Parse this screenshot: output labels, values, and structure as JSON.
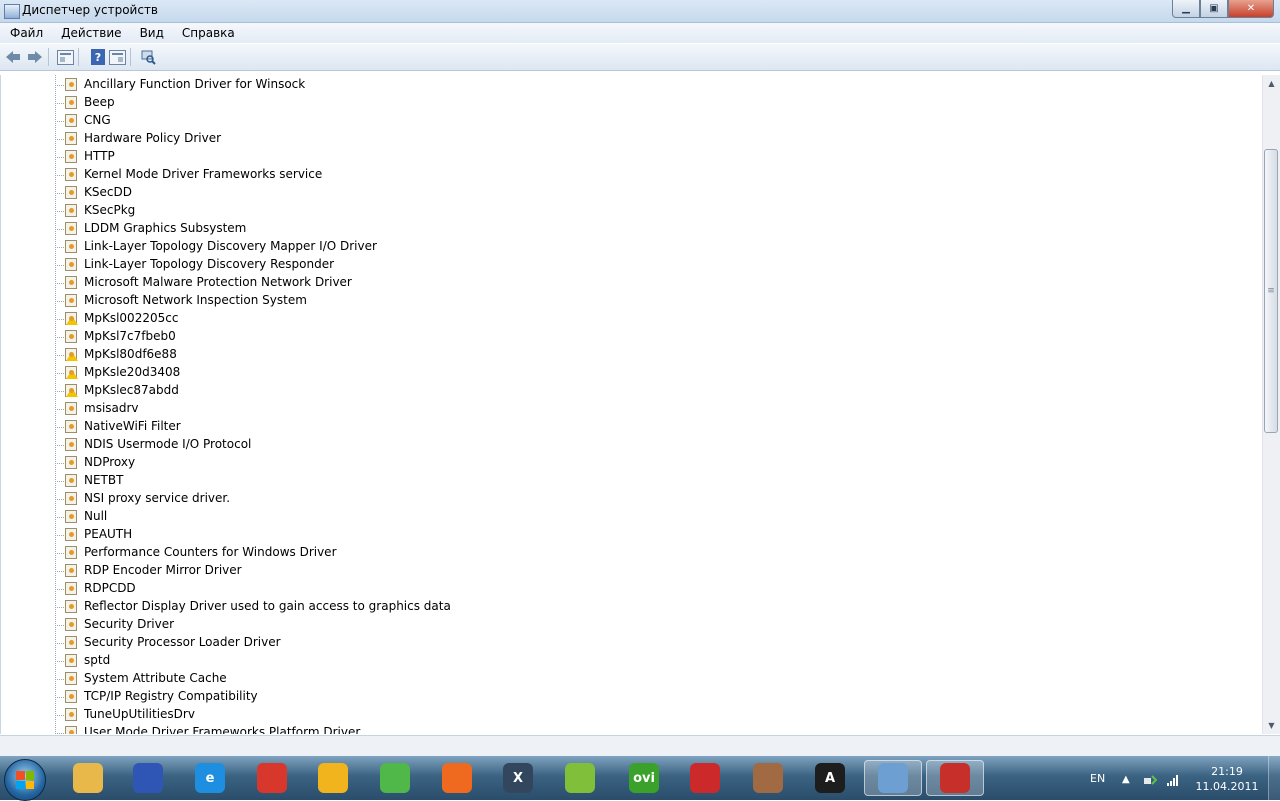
{
  "window": {
    "title": "Диспетчер устройств",
    "buttons": {
      "minimize": "▁",
      "maximize": "▣",
      "close": "✕"
    }
  },
  "menu": [
    "Файл",
    "Действие",
    "Вид",
    "Справка"
  ],
  "toolbar": {
    "back_icon": "back-arrow-icon",
    "forward_icon": "forward-arrow-icon",
    "properties_icon": "properties-icon",
    "help_icon": "help-icon",
    "help_label": "?",
    "view_icon": "view-icon",
    "scan_icon": "scan-hardware-icon"
  },
  "tree": {
    "items": [
      {
        "label": "Ancillary Function Driver for Winsock",
        "warn": false
      },
      {
        "label": "Beep",
        "warn": false
      },
      {
        "label": "CNG",
        "warn": false
      },
      {
        "label": "Hardware Policy Driver",
        "warn": false
      },
      {
        "label": "HTTP",
        "warn": false
      },
      {
        "label": "Kernel Mode Driver Frameworks service",
        "warn": false
      },
      {
        "label": "KSecDD",
        "warn": false
      },
      {
        "label": "KSecPkg",
        "warn": false
      },
      {
        "label": "LDDM Graphics Subsystem",
        "warn": false
      },
      {
        "label": "Link-Layer Topology Discovery Mapper I/O Driver",
        "warn": false
      },
      {
        "label": "Link-Layer Topology Discovery Responder",
        "warn": false
      },
      {
        "label": "Microsoft Malware Protection Network Driver",
        "warn": false
      },
      {
        "label": "Microsoft Network Inspection System",
        "warn": false
      },
      {
        "label": "MpKsl002205cc",
        "warn": true
      },
      {
        "label": "MpKsl7c7fbeb0",
        "warn": false
      },
      {
        "label": "MpKsl80df6e88",
        "warn": true
      },
      {
        "label": "MpKsle20d3408",
        "warn": true
      },
      {
        "label": "MpKslec87abdd",
        "warn": true
      },
      {
        "label": "msisadrv",
        "warn": false
      },
      {
        "label": "NativeWiFi Filter",
        "warn": false
      },
      {
        "label": "NDIS Usermode I/O Protocol",
        "warn": false
      },
      {
        "label": "NDProxy",
        "warn": false
      },
      {
        "label": "NETBT",
        "warn": false
      },
      {
        "label": "NSI proxy service driver.",
        "warn": false
      },
      {
        "label": "Null",
        "warn": false
      },
      {
        "label": "PEAUTH",
        "warn": false
      },
      {
        "label": "Performance Counters for Windows Driver",
        "warn": false
      },
      {
        "label": "RDP Encoder Mirror Driver",
        "warn": false
      },
      {
        "label": "RDPCDD",
        "warn": false
      },
      {
        "label": "Reflector Display Driver used to gain access to graphics data",
        "warn": false
      },
      {
        "label": "Security Driver",
        "warn": false
      },
      {
        "label": "Security Processor Loader Driver",
        "warn": false
      },
      {
        "label": "sptd",
        "warn": false
      },
      {
        "label": "System Attribute Cache",
        "warn": false
      },
      {
        "label": "TCP/IP Registry Compatibility",
        "warn": false
      },
      {
        "label": "TuneUpUtilitiesDrv",
        "warn": false
      },
      {
        "label": "User Mode Driver Frameworks Platform Driver",
        "warn": false
      }
    ]
  },
  "scrollbar": {
    "up": "▲",
    "down": "▼",
    "grip": "≡"
  },
  "taskbar": {
    "apps": [
      {
        "name": "explorer-icon",
        "glyph": "",
        "color": "#e8b84a",
        "active": false
      },
      {
        "name": "save-disk-icon",
        "glyph": "",
        "color": "#2f56b5",
        "active": false
      },
      {
        "name": "internet-explorer-icon",
        "glyph": "e",
        "color": "#1e8fe0",
        "active": false
      },
      {
        "name": "chrome-icon",
        "glyph": "",
        "color": "#d8372b",
        "active": false
      },
      {
        "name": "game-icon",
        "glyph": "",
        "color": "#f2b41c",
        "active": false
      },
      {
        "name": "yandex-disk-icon",
        "glyph": "",
        "color": "#4fb848",
        "active": false
      },
      {
        "name": "firefox-icon",
        "glyph": "",
        "color": "#ef6a1f",
        "active": false
      },
      {
        "name": "crossover-icon",
        "glyph": "X",
        "color": "#32475e",
        "active": false
      },
      {
        "name": "sync-icon",
        "glyph": "",
        "color": "#7fbf3a",
        "active": false
      },
      {
        "name": "ovi-icon",
        "glyph": "ovi",
        "color": "#3aa22a",
        "active": false
      },
      {
        "name": "ccleaner-icon",
        "glyph": "",
        "color": "#cc2a2a",
        "active": false
      },
      {
        "name": "handshake-icon",
        "glyph": "",
        "color": "#a26a43",
        "active": false
      },
      {
        "name": "abbyy-icon",
        "glyph": "A",
        "color": "#1d1d1d",
        "active": false
      },
      {
        "name": "device-manager-icon",
        "glyph": "",
        "color": "#6d9fd2",
        "active": true
      },
      {
        "name": "toolbox-icon",
        "glyph": "",
        "color": "#c7302a",
        "active": true
      }
    ],
    "language": "EN",
    "tray_icons": [
      "tray-arrow-icon",
      "network-icon",
      "signal-icon"
    ],
    "clock_time": "21:19",
    "clock_date": "11.04.2011"
  }
}
